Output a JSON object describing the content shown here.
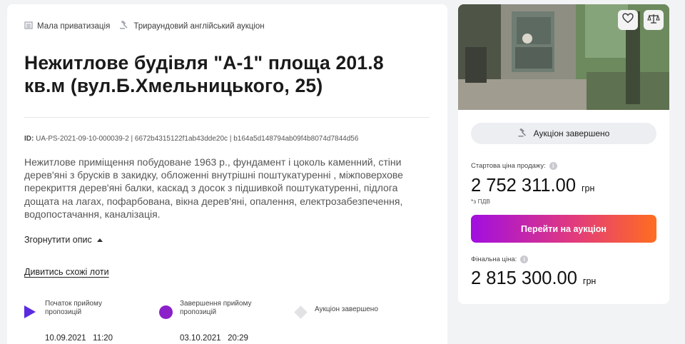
{
  "lot": {
    "tags": [
      {
        "icon": "building-icon",
        "label": "Мала приватизація"
      },
      {
        "icon": "gavel-icon",
        "label": "Трираундовий англійський аукціон"
      }
    ],
    "title": "Нежитлове будівля \"А-1\" площа 201.8 кв.м (вул.Б.Хмельницького, 25)",
    "id_label": "ID:",
    "id_value": "UA-PS-2021-09-10-000039-2 | 6672b4315122f1ab43dde20c | b164a5d148794ab09f4b8074d7844d56",
    "description": "Нежитлове приміщення побудоване 1963 р., фундамент і цоколь каменний, стіни дерев'яні з брусків в закидку, обложенні внутрішні поштукатуренні , міжповерхове перекриття дерев'яні балки, каскад з досок з підшивкой поштукатуренні, підлога дощата на лагах, пофарбована, вікна дерев'яні, опалення, електрозабезпечення, водопостачання, каналізація.",
    "collapse_label": "Згорнутити опис",
    "similar_link": "Дивитись схожі лоти"
  },
  "timeline": [
    {
      "marker": "play-icon",
      "color": "#5b2be0",
      "label": "Початок прийому пропозицій",
      "date": "10.09.2021",
      "time": "11:20"
    },
    {
      "marker": "circle-icon",
      "color": "#8b20c9",
      "label": "Завершення прийому пропозицій",
      "date": "03.10.2021",
      "time": "20:29"
    },
    {
      "marker": "diamond-icon",
      "color": "#e2e2e4",
      "label": "Аукціон завершено",
      "date": "",
      "time": ""
    }
  ],
  "sidebar": {
    "favorite_icon": "heart-icon",
    "compare_icon": "scales-icon",
    "status": "Аукціон завершено",
    "start_price_label": "Стартова ціна продажу:",
    "start_price": "2 752 311.00",
    "currency": "грн",
    "vat_note": "*з ПДВ",
    "go_button": "Перейти на аукціон",
    "final_price_label": "Фінальна ціна:",
    "final_price": "2 815 300.00"
  },
  "colors": {
    "accent_purple": "#8b20c9",
    "button_gradient_start": "#a10ee0",
    "button_gradient_end": "#ff6d1f"
  }
}
